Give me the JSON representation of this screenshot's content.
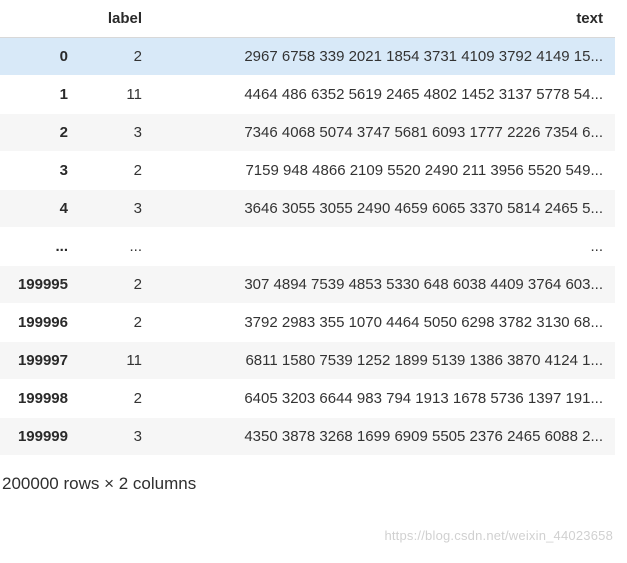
{
  "columns": {
    "idx_header": "",
    "label_header": "label",
    "text_header": "text"
  },
  "rows": [
    {
      "idx": "0",
      "label": "2",
      "text": "2967 6758 339 2021 1854 3731 4109 3792 4149 15...",
      "highlight": true
    },
    {
      "idx": "1",
      "label": "11",
      "text": "4464 486 6352 5619 2465 4802 1452 3137 5778 54..."
    },
    {
      "idx": "2",
      "label": "3",
      "text": "7346 4068 5074 3747 5681 6093 1777 2226 7354 6..."
    },
    {
      "idx": "3",
      "label": "2",
      "text": "7159 948 4866 2109 5520 2490 211 3956 5520 549..."
    },
    {
      "idx": "4",
      "label": "3",
      "text": "3646 3055 3055 2490 4659 6065 3370 5814 2465 5..."
    },
    {
      "idx": "...",
      "label": "...",
      "text": "...",
      "ellipsis": true
    },
    {
      "idx": "199995",
      "label": "2",
      "text": "307 4894 7539 4853 5330 648 6038 4409 3764 603..."
    },
    {
      "idx": "199996",
      "label": "2",
      "text": "3792 2983 355 1070 4464 5050 6298 3782 3130 68..."
    },
    {
      "idx": "199997",
      "label": "11",
      "text": "6811 1580 7539 1252 1899 5139 1386 3870 4124 1..."
    },
    {
      "idx": "199998",
      "label": "2",
      "text": "6405 3203 6644 983 794 1913 1678 5736 1397 191..."
    },
    {
      "idx": "199999",
      "label": "3",
      "text": "4350 3878 3268 1699 6909 5505 2376 2465 6088 2..."
    }
  ],
  "shape_text": "200000 rows × 2 columns",
  "watermark": "https://blog.csdn.net/weixin_44023658"
}
